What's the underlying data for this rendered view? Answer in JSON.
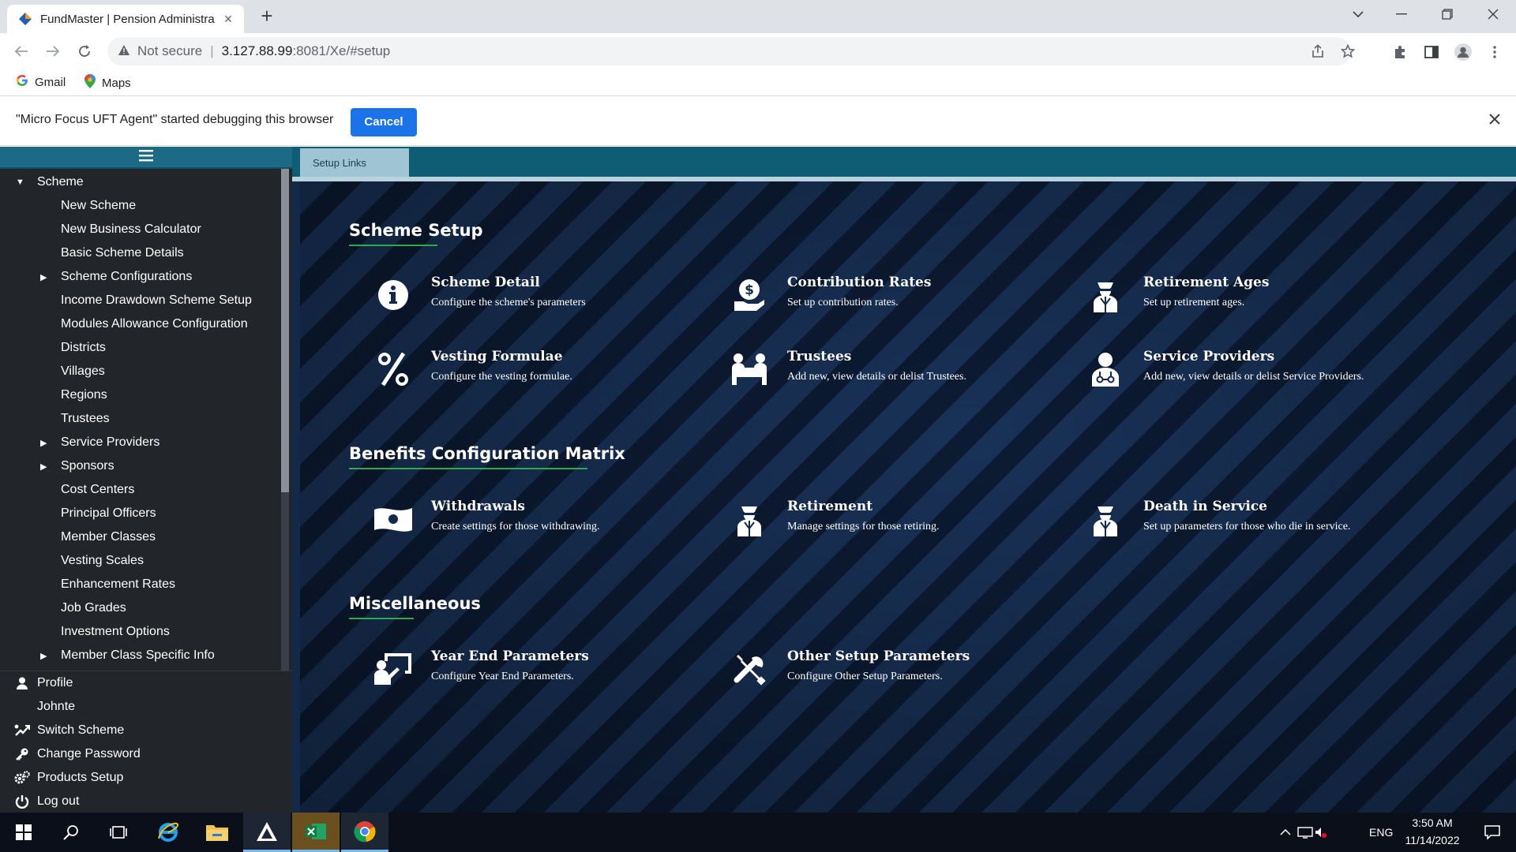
{
  "browser": {
    "tab_title": "FundMaster | Pension Administra",
    "url_warning": "Not secure",
    "url_host": "3.127.88.99",
    "url_path": ":8081/Xe/#setup",
    "bookmarks": [
      {
        "label": "Gmail",
        "icon": "google-icon"
      },
      {
        "label": "Maps",
        "icon": "maps-icon"
      }
    ],
    "infobar_text": "\"Micro Focus UFT Agent\" started debugging this browser",
    "infobar_cancel": "Cancel"
  },
  "sidebar": {
    "menu_icon": "hamburger-icon",
    "items": [
      {
        "label": "Scheme",
        "level": 0,
        "arrow": "down"
      },
      {
        "label": "New Scheme",
        "level": 1,
        "arrow": ""
      },
      {
        "label": "New Business Calculator",
        "level": 1,
        "arrow": ""
      },
      {
        "label": "Basic Scheme Details",
        "level": 1,
        "arrow": ""
      },
      {
        "label": "Scheme Configurations",
        "level": 1,
        "arrow": "right"
      },
      {
        "label": "Income Drawdown Scheme Setup",
        "level": 1,
        "arrow": ""
      },
      {
        "label": "Modules Allowance Configuration",
        "level": 1,
        "arrow": ""
      },
      {
        "label": "Districts",
        "level": 1,
        "arrow": ""
      },
      {
        "label": "Villages",
        "level": 1,
        "arrow": ""
      },
      {
        "label": "Regions",
        "level": 1,
        "arrow": ""
      },
      {
        "label": "Trustees",
        "level": 1,
        "arrow": ""
      },
      {
        "label": "Service Providers",
        "level": 1,
        "arrow": "right"
      },
      {
        "label": "Sponsors",
        "level": 1,
        "arrow": "right"
      },
      {
        "label": "Cost Centers",
        "level": 1,
        "arrow": ""
      },
      {
        "label": "Principal Officers",
        "level": 1,
        "arrow": ""
      },
      {
        "label": "Member Classes",
        "level": 1,
        "arrow": ""
      },
      {
        "label": "Vesting Scales",
        "level": 1,
        "arrow": ""
      },
      {
        "label": "Enhancement Rates",
        "level": 1,
        "arrow": ""
      },
      {
        "label": "Job Grades",
        "level": 1,
        "arrow": ""
      },
      {
        "label": "Investment Options",
        "level": 1,
        "arrow": ""
      },
      {
        "label": "Member Class Specific Info",
        "level": 1,
        "arrow": "right"
      }
    ],
    "bottom": [
      {
        "label": "Profile",
        "icon": "user-icon"
      },
      {
        "label": "Johnte",
        "icon": ""
      },
      {
        "label": "Switch Scheme",
        "icon": "switch-icon"
      },
      {
        "label": "Change Password",
        "icon": "key-icon"
      },
      {
        "label": "Products Setup",
        "icon": "cogs-icon"
      },
      {
        "label": "Log out",
        "icon": "power-icon"
      }
    ]
  },
  "main": {
    "tab_label": "Setup Links",
    "sections": [
      {
        "title": "Scheme Setup",
        "cards": [
          {
            "title": "Scheme Detail",
            "desc": "Configure the scheme's parameters",
            "icon": "info-icon"
          },
          {
            "title": "Contribution Rates",
            "desc": "Set up contribution rates.",
            "icon": "money-hand-icon"
          },
          {
            "title": "Retirement Ages",
            "desc": "Set up retirement ages.",
            "icon": "retiree-icon"
          },
          {
            "title": "Vesting Formulae",
            "desc": "Configure the vesting formulae.",
            "icon": "percent-icon"
          },
          {
            "title": "Trustees",
            "desc": "Add new, view details or delist Trustees.",
            "icon": "trustees-icon"
          },
          {
            "title": "Service Providers",
            "desc": "Add new, view details or delist Service Providers.",
            "icon": "provider-icon"
          }
        ]
      },
      {
        "title": "Benefits Configuration Matrix",
        "cards": [
          {
            "title": "Withdrawals",
            "desc": "Create settings for those withdrawing.",
            "icon": "banknote-icon"
          },
          {
            "title": "Retirement",
            "desc": "Manage settings for those retiring.",
            "icon": "retiree-icon"
          },
          {
            "title": "Death in Service",
            "desc": "Set up parameters for those who die in service.",
            "icon": "retiree-icon"
          }
        ]
      },
      {
        "title": "Miscellaneous",
        "cards": [
          {
            "title": "Year End Parameters",
            "desc": "Configure Year End Parameters.",
            "icon": "presenter-icon"
          },
          {
            "title": "Other Setup Parameters",
            "desc": "Configure Other Setup Parameters.",
            "icon": "tools-icon"
          }
        ]
      }
    ]
  },
  "taskbar": {
    "lang": "ENG",
    "time": "3:50 AM",
    "date": "11/14/2022"
  }
}
